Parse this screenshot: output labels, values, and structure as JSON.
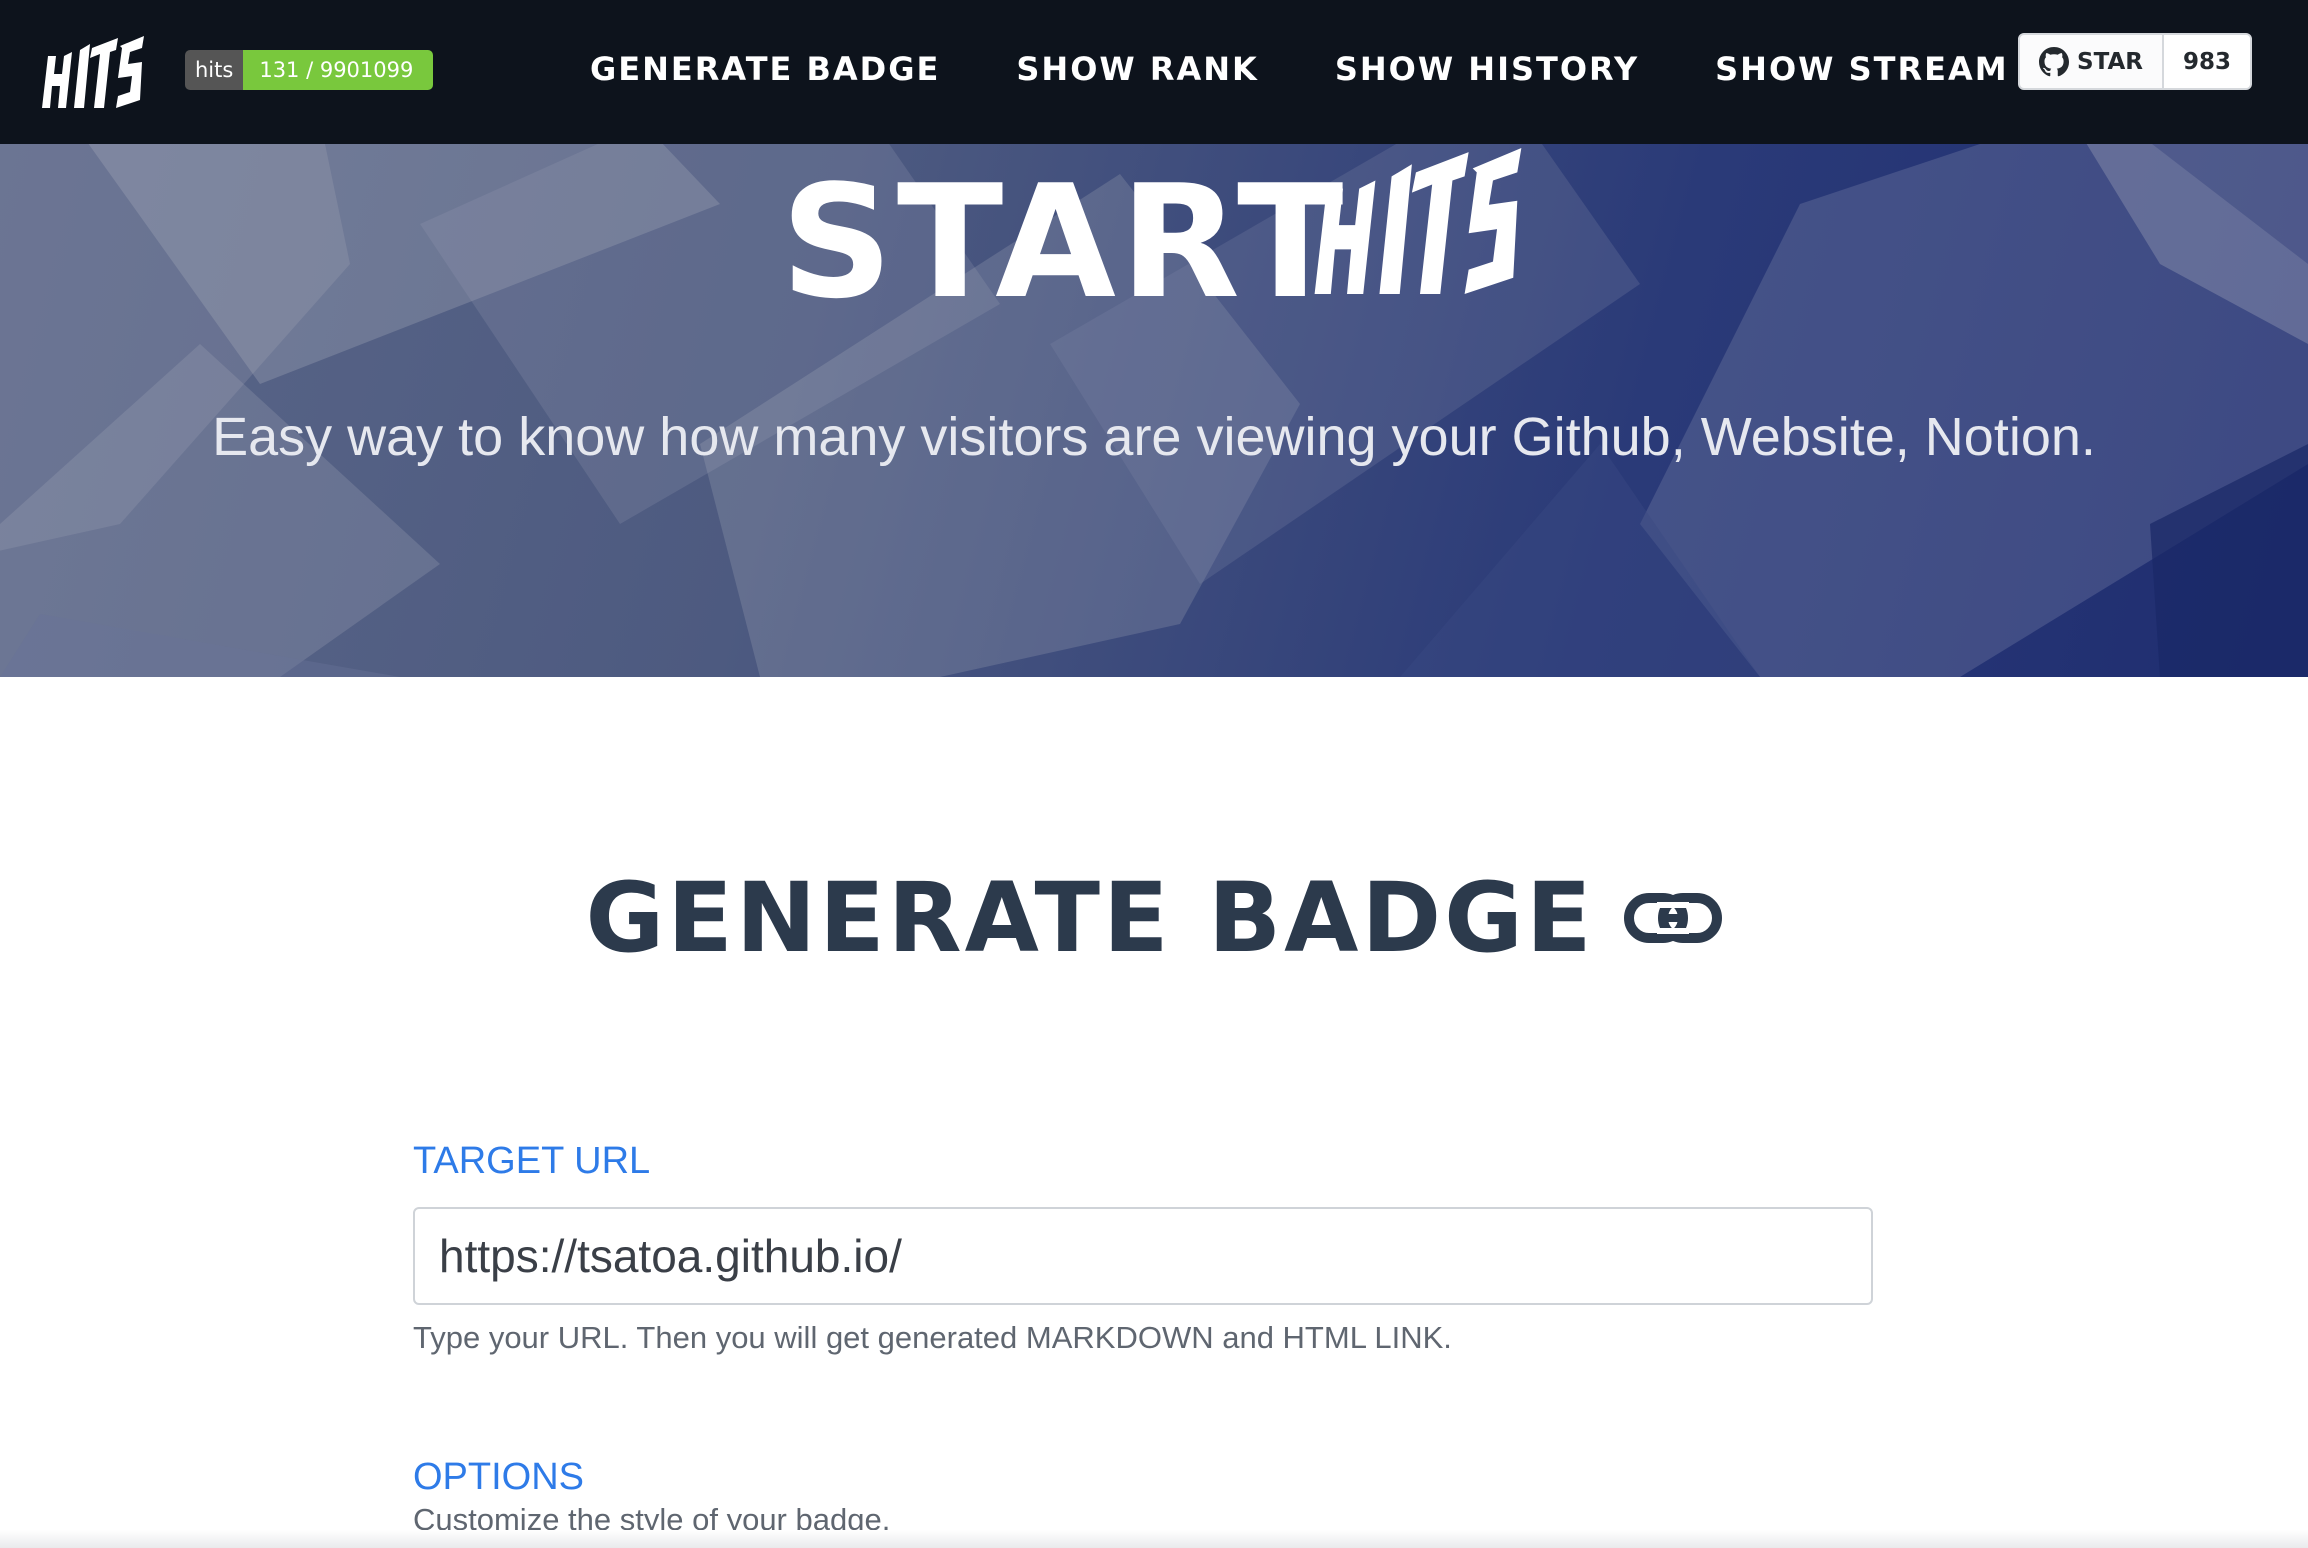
{
  "navbar": {
    "logo_icon": "hits-logo",
    "hits_badge": {
      "label": "hits",
      "value": "131 / 9901099"
    },
    "links": [
      {
        "label": "GENERATE BADGE"
      },
      {
        "label": "SHOW RANK"
      },
      {
        "label": "SHOW HISTORY"
      },
      {
        "label": "SHOW STREAM"
      }
    ],
    "github_star": {
      "icon": "github-icon",
      "label": "STAR",
      "count": "983"
    }
  },
  "hero": {
    "title_word": "START",
    "title_logo_icon": "hits-logo",
    "subtitle": "Easy way to know how many visitors are viewing your Github, Website, Notion."
  },
  "main": {
    "title": "GENERATE BADGE",
    "title_icon": "link-icon",
    "target": {
      "label": "TARGET URL",
      "value": "https://tsatoa.github.io/",
      "help": "Type your URL. Then you will get generated MARKDOWN and HTML LINK."
    },
    "options": {
      "label": "OPTIONS",
      "help": "Customize the style of your badge."
    }
  },
  "colors": {
    "navbar_bg": "#0d131c",
    "badge_label_bg": "#555555",
    "badge_value_bg": "#79c83d",
    "hero_dark": "#1f2d70",
    "title_text": "#2c3a4c",
    "accent_blue": "#2e7be8"
  }
}
